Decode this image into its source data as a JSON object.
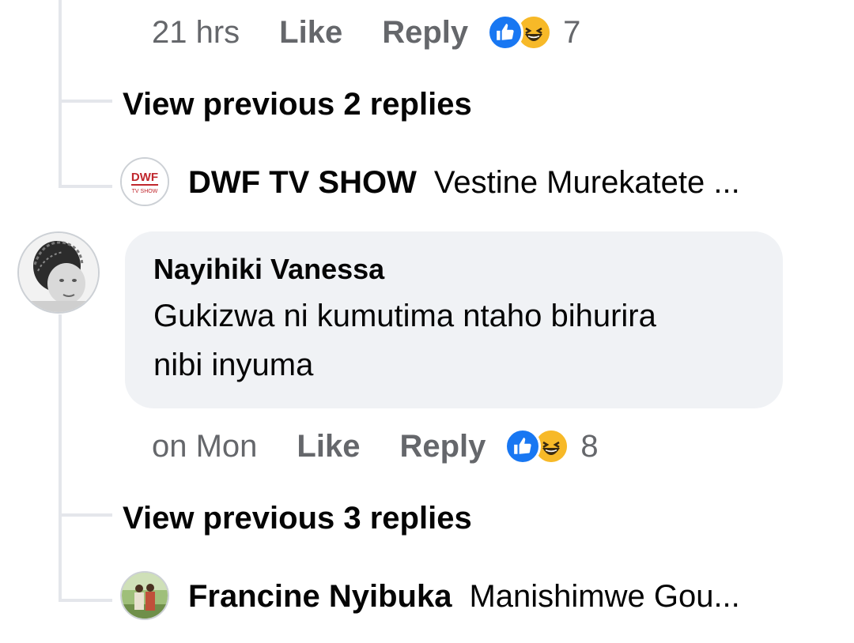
{
  "top_comment": {
    "time": "21 hrs",
    "like_label": "Like",
    "reply_label": "Reply",
    "reaction_count": "7",
    "reactions": [
      "like-icon",
      "haha-icon"
    ]
  },
  "thread1": {
    "view_previous": "View previous 2 replies",
    "last_reply": {
      "name": "DWF TV SHOW",
      "text": "Vestine Murekatete ...",
      "avatar_logo": "DWF"
    }
  },
  "comment": {
    "author": "Nayihiki Vanessa",
    "text_line1": "Gukizwa ni kumutima ntaho bihurira",
    "text_line2": "nibi inyuma",
    "time": "on Mon",
    "like_label": "Like",
    "reply_label": "Reply",
    "reaction_count": "8",
    "reactions": [
      "like-icon",
      "haha-icon"
    ]
  },
  "thread2": {
    "view_previous": "View previous 3 replies",
    "last_reply": {
      "name": "Francine Nyibuka",
      "text": "Manishimwe Gou..."
    }
  },
  "colors": {
    "line": "#e4e6eb",
    "meta_text": "#65676b",
    "bubble_bg": "#f0f2f5",
    "like_blue": "#1877f2",
    "haha_yellow": "#f7b928"
  }
}
